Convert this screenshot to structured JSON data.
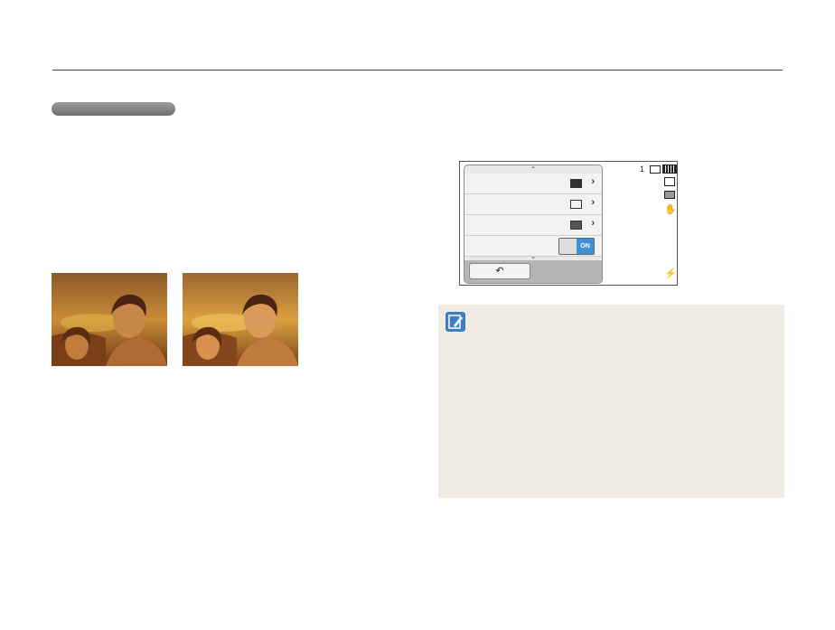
{
  "page": {
    "colors": {
      "rule": "#444444",
      "pill": "#7a7a7a",
      "note_bg": "#f1ece3",
      "toggle_on": "#3f8fd2"
    }
  },
  "photos": [
    {
      "name": "photo-before"
    },
    {
      "name": "photo-after"
    }
  ],
  "camera_screen": {
    "menu_rows": [
      {
        "icon": "rectangle-icon"
      },
      {
        "icon": "image-adjust-icon"
      },
      {
        "icon": "landscape-icon"
      },
      {
        "icon": "toggle",
        "toggle_label": "ON"
      }
    ],
    "back_icon": "back-arrow-icon",
    "status": {
      "shots": "1",
      "icons": [
        "memory-card-icon",
        "battery-icon",
        "image-size-icon",
        "metering-icon",
        "stabilizer-icon",
        "flash-icon"
      ]
    }
  },
  "note": {
    "icon": "note-pencil-icon"
  }
}
